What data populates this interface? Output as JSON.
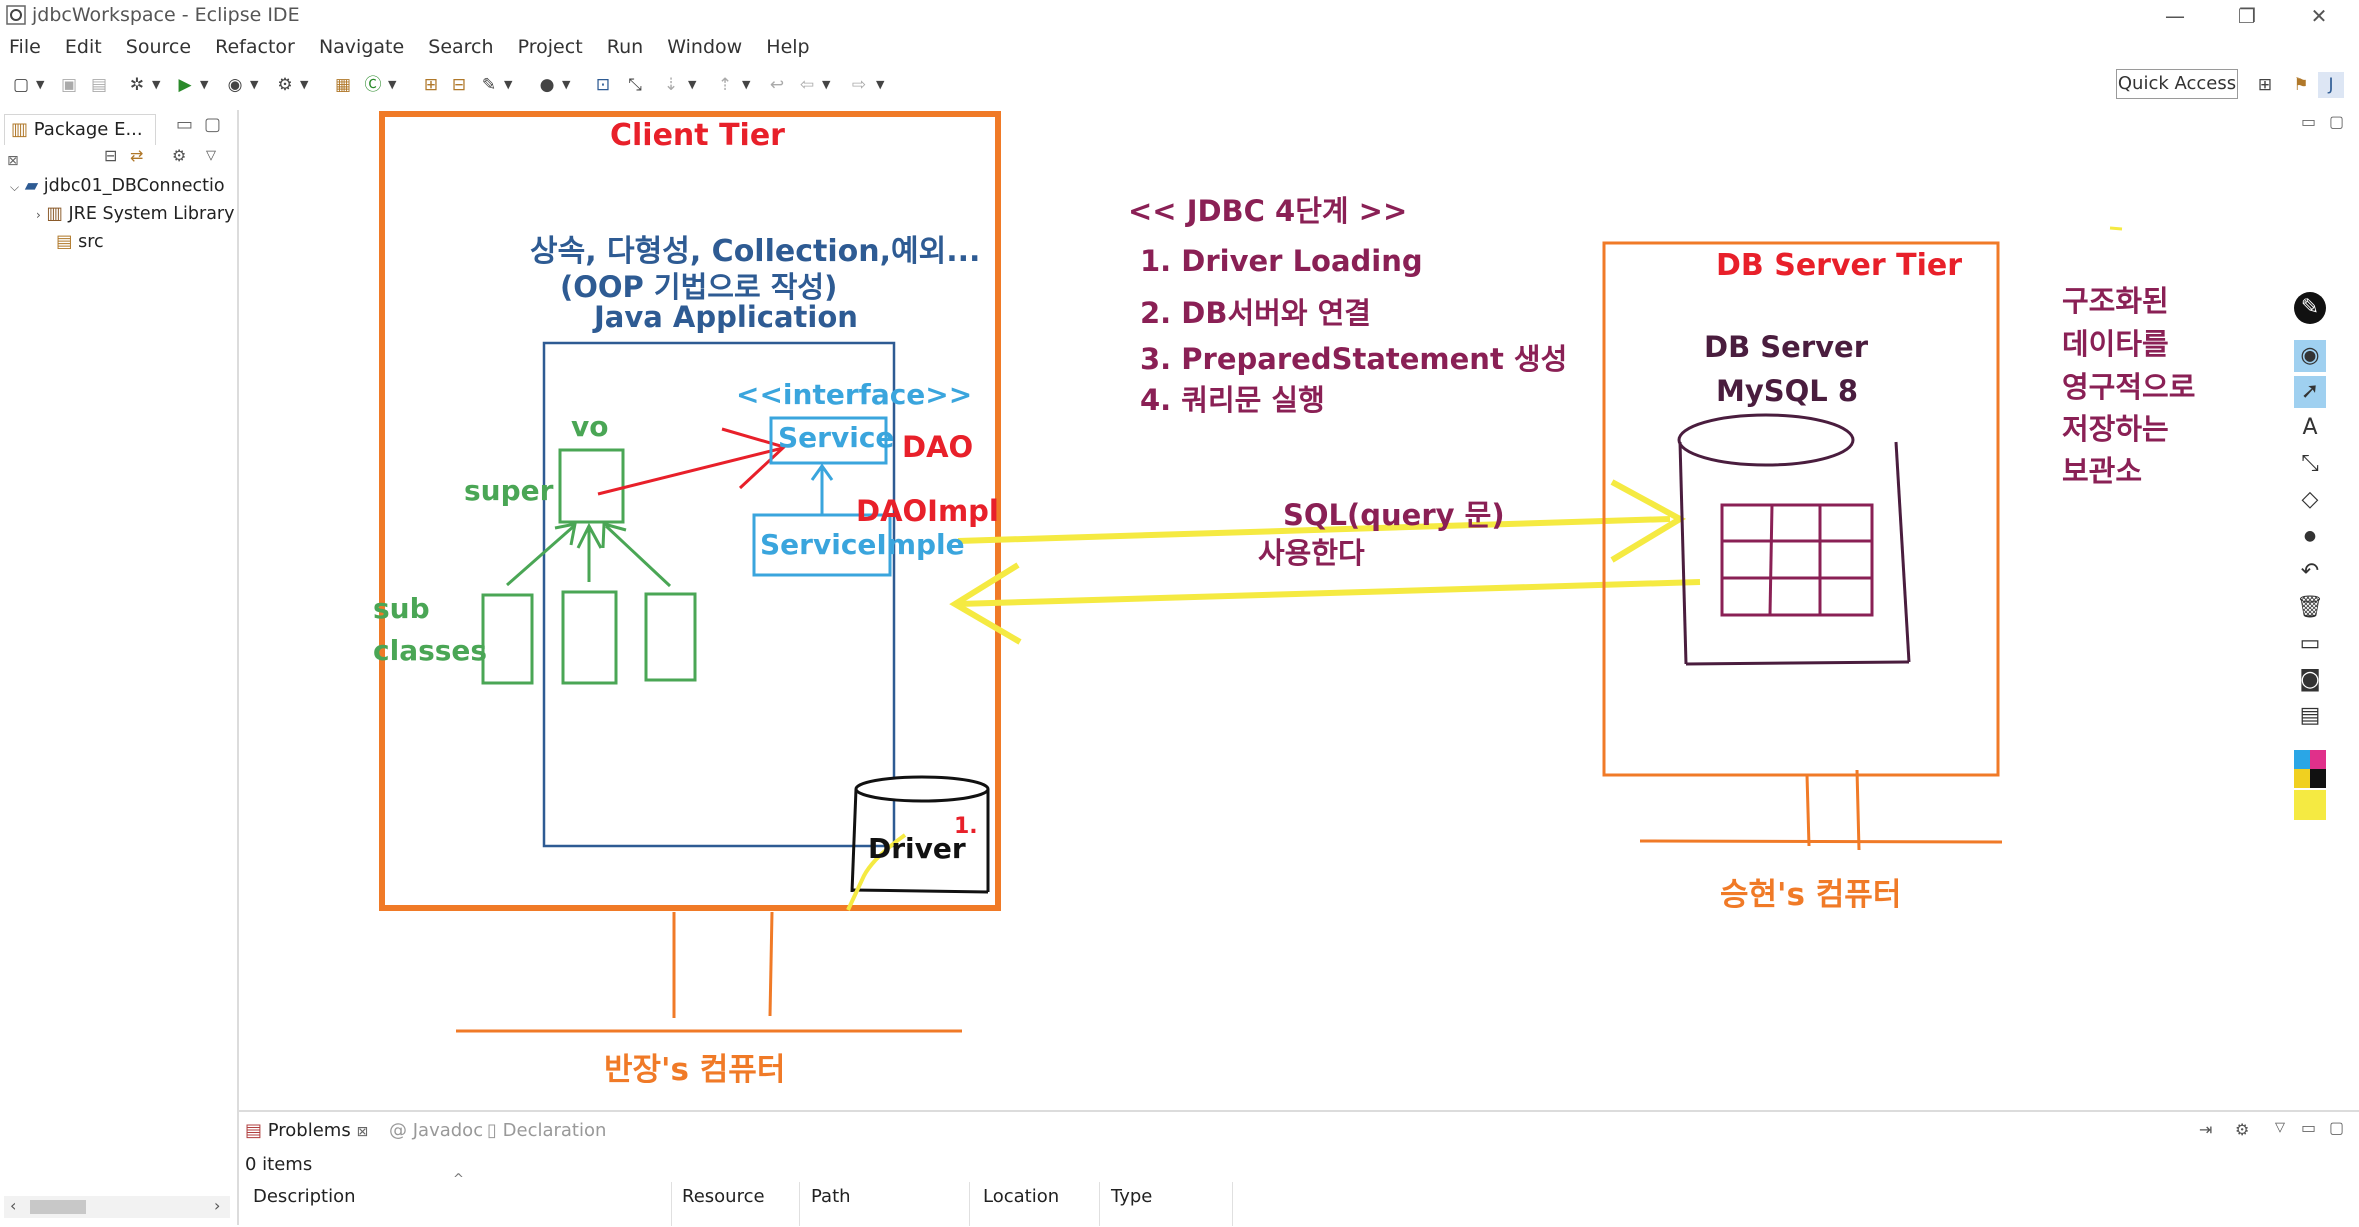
{
  "window": {
    "title": "jdbcWorkspace - Eclipse IDE",
    "controls": {
      "minimize": "—",
      "restore": "❐",
      "close": "✕"
    }
  },
  "menu": [
    "File",
    "Edit",
    "Source",
    "Refactor",
    "Navigate",
    "Search",
    "Project",
    "Run",
    "Window",
    "Help"
  ],
  "toolbar": {
    "quick_access": "Quick Access"
  },
  "package_explorer": {
    "tab_label": "Package E...",
    "close": "⊠",
    "tree": {
      "project": "jdbc01_DBConnectio",
      "children": [
        "JRE System Library",
        "src"
      ]
    }
  },
  "diagram": {
    "client_tier": {
      "title": "Client Tier",
      "desc_line1": "상속, 다형성, Collection,예외...",
      "desc_line2": "(OOP 기법으로 작성)",
      "desc_line3": "Java Application",
      "vo": "vo",
      "super": "super",
      "sub": "sub",
      "classes": "classes",
      "interface": "<<interface>>",
      "service": "Service",
      "dao": "DAO",
      "daoimpl": "DAOImpl",
      "serviceimple": "ServiceImple",
      "driver": "Driver",
      "driver_num": "1."
    },
    "jdbc_steps": {
      "title": "<< JDBC 4단계 >>",
      "steps": [
        "1.  Driver Loading",
        "2. DB서버와 연결",
        "3.  PreparedStatement 생성",
        "4.  쿼리문 실행"
      ]
    },
    "sql_label_1": "SQL(query 문)",
    "sql_label_2": "사용한다",
    "db_tier": {
      "title": "DB Server Tier",
      "server_line1": "DB Server",
      "server_line2": "MySQL 8"
    },
    "storage_note": [
      "구조화된",
      "데이타를",
      "영구적으로",
      "저장하는",
      "보관소"
    ],
    "client_computer": "반장's  컴퓨터",
    "server_computer": "승현's 컴퓨터",
    "colors": {
      "orange": "#f07a27",
      "red_title": "#e8202a",
      "blue": "#2e5b93",
      "green": "#4aa655",
      "cyan": "#3aa5dd",
      "purple": "#8a2055",
      "yellow": "#f5ea42",
      "dark_purple": "#4a1d3e"
    }
  },
  "bottom_panel": {
    "tabs": [
      "Problems",
      "Javadoc",
      "Declaration"
    ],
    "items_count": "0 items",
    "columns": [
      "Description",
      "Resource",
      "Path",
      "Location",
      "Type"
    ]
  }
}
